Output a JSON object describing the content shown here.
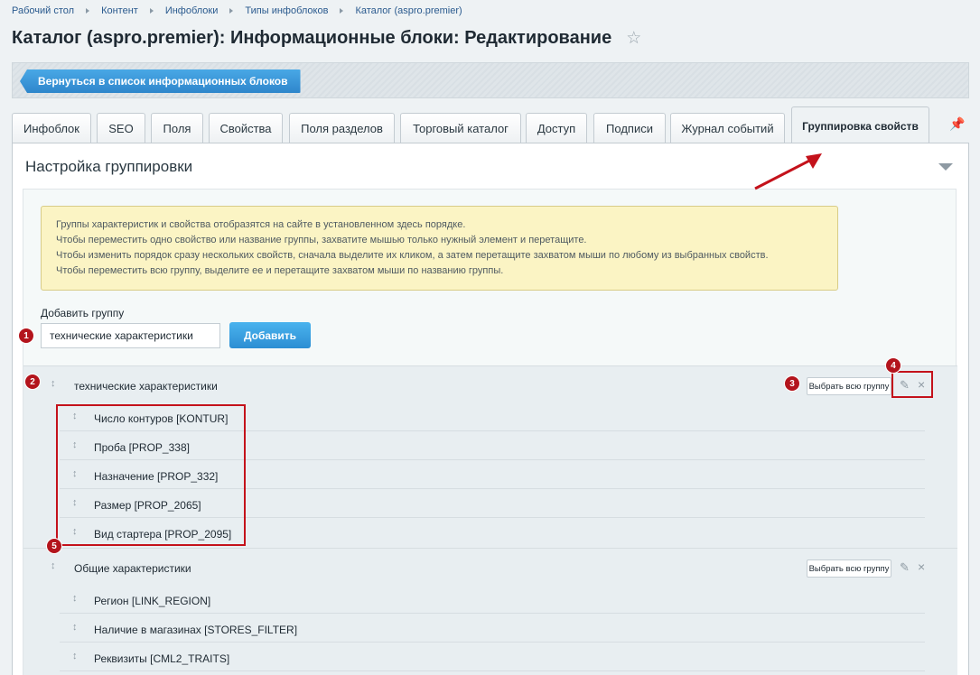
{
  "breadcrumb": [
    "Рабочий стол",
    "Контент",
    "Инфоблоки",
    "Типы инфоблоков",
    "Каталог (aspro.premier)"
  ],
  "title": "Каталог (aspro.premier): Информационные блоки: Редактирование",
  "back_button": "Вернуться в список информационных блоков",
  "tabs": [
    "Инфоблок",
    "SEO",
    "Поля",
    "Свойства",
    "Поля разделов",
    "Торговый каталог",
    "Доступ",
    "Подписи",
    "Журнал событий",
    "Группировка свойств"
  ],
  "active_tab": "Группировка свойств",
  "section_title": "Настройка группировки",
  "notice_lines": [
    "Группы характеристик и свойства отобразятся на сайте в установленном здесь порядке.",
    "Чтобы переместить одно свойство или название группы, захватите мышью только нужный элемент и перетащите.",
    "Чтобы изменить порядок сразу нескольких свойств, сначала выделите их кликом, а затем перетащите захватом мыши по любому из выбранных свойств.",
    "Чтобы переместить всю группу, выделите ее и перетащите захватом мыши по названию группы."
  ],
  "add_group": {
    "label": "Добавить группу",
    "value": "технические характеристики",
    "button": "Добавить"
  },
  "groups": [
    {
      "name": "технические характеристики",
      "select_all": "Выбрать всю группу",
      "properties": [
        "Число контуров [KONTUR]",
        "Проба [PROP_338]",
        "Назначение [PROP_332]",
        "Размер [PROP_2065]",
        "Вид стартера [PROP_2095]"
      ]
    },
    {
      "name": "Общие характеристики",
      "select_all": "Выбрать всю группу",
      "properties": [
        "Регион [LINK_REGION]",
        "Наличие в магазинах [STORES_FILTER]",
        "Реквизиты [CML2_TRAITS]"
      ]
    }
  ],
  "markers": [
    "1",
    "2",
    "3",
    "4",
    "5"
  ],
  "icons": {
    "star": "star-icon",
    "pin": "pin-icon",
    "drag": "drag-handle-icon",
    "edit": "pencil-icon",
    "close": "close-icon",
    "collapse": "chevron-down-icon"
  },
  "colors": {
    "accent_blue": "#2e86cb",
    "annotation_red": "#c4121b",
    "notice_bg": "#fbf4c4"
  }
}
